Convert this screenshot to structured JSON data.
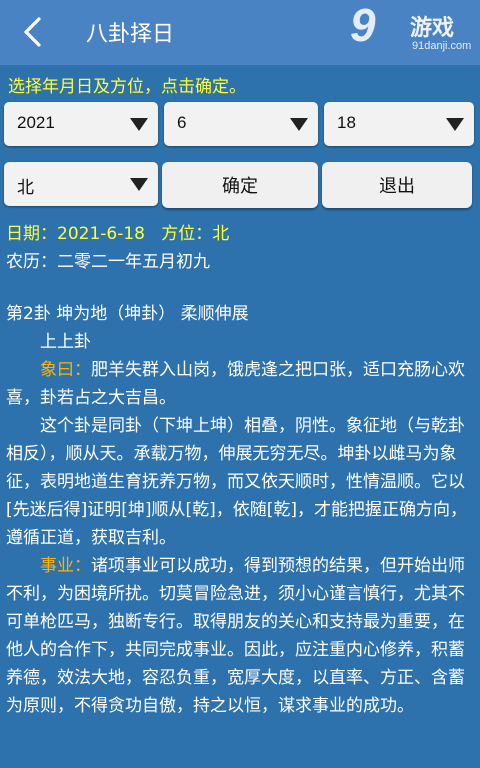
{
  "header": {
    "title": "八卦择日",
    "back_icon": "back-arrow-icon",
    "watermark": {
      "logo": "9",
      "name": "游戏",
      "url": "91danji.com"
    }
  },
  "instruction": "选择年月日及方位，点击确定。",
  "selectors": {
    "year": "2021",
    "month": "6",
    "day": "18",
    "direction": "北"
  },
  "buttons": {
    "confirm": "确定",
    "exit": "退出"
  },
  "result": {
    "date_line": "日期：2021-6-18",
    "direction_line": "方位：北",
    "lunar": "农历：二零二一年五月初九",
    "gua_title": "第2卦 坤为地（坤卦） 柔顺伸展",
    "grade": "上上卦",
    "xiang_label": "象曰：",
    "xiang_text": "肥羊失群入山岗，饿虎逢之把口张，适口充肠心欢喜，卦若占之大吉昌。",
    "desc": "这个卦是同卦（下坤上坤）相叠，阴性。象征地（与乾卦相反），顺从天。承载万物，伸展无穷无尽。坤卦以雌马为象征，表明地道生育抚养万物，而又依天顺时，性情温顺。它以[先迷后得]证明[坤]顺从[乾]，依随[乾]，才能把握正确方向，遵循正道，获取吉利。",
    "career_label": "事业：",
    "career_text": "诸项事业可以成功，得到预想的结果，但开始出师不利，为困境所扰。切莫冒险急进，须小心谨言慎行，尤其不可单枪匹马，独断专行。取得朋友的关心和支持最为重要，在他人的合作下，共同完成事业。因此，应注重内心修养，积蓄养德，效法大地，容忍负重，宽厚大度，以直率、方正、含蓄为原则，不得贪功自傲，持之以恒，谋求事业的成功。"
  },
  "colors": {
    "background": "#2d72ad",
    "titlebar": "#4a83c4",
    "highlight_yellow": "#ffff33",
    "highlight_orange": "#ffb300"
  }
}
